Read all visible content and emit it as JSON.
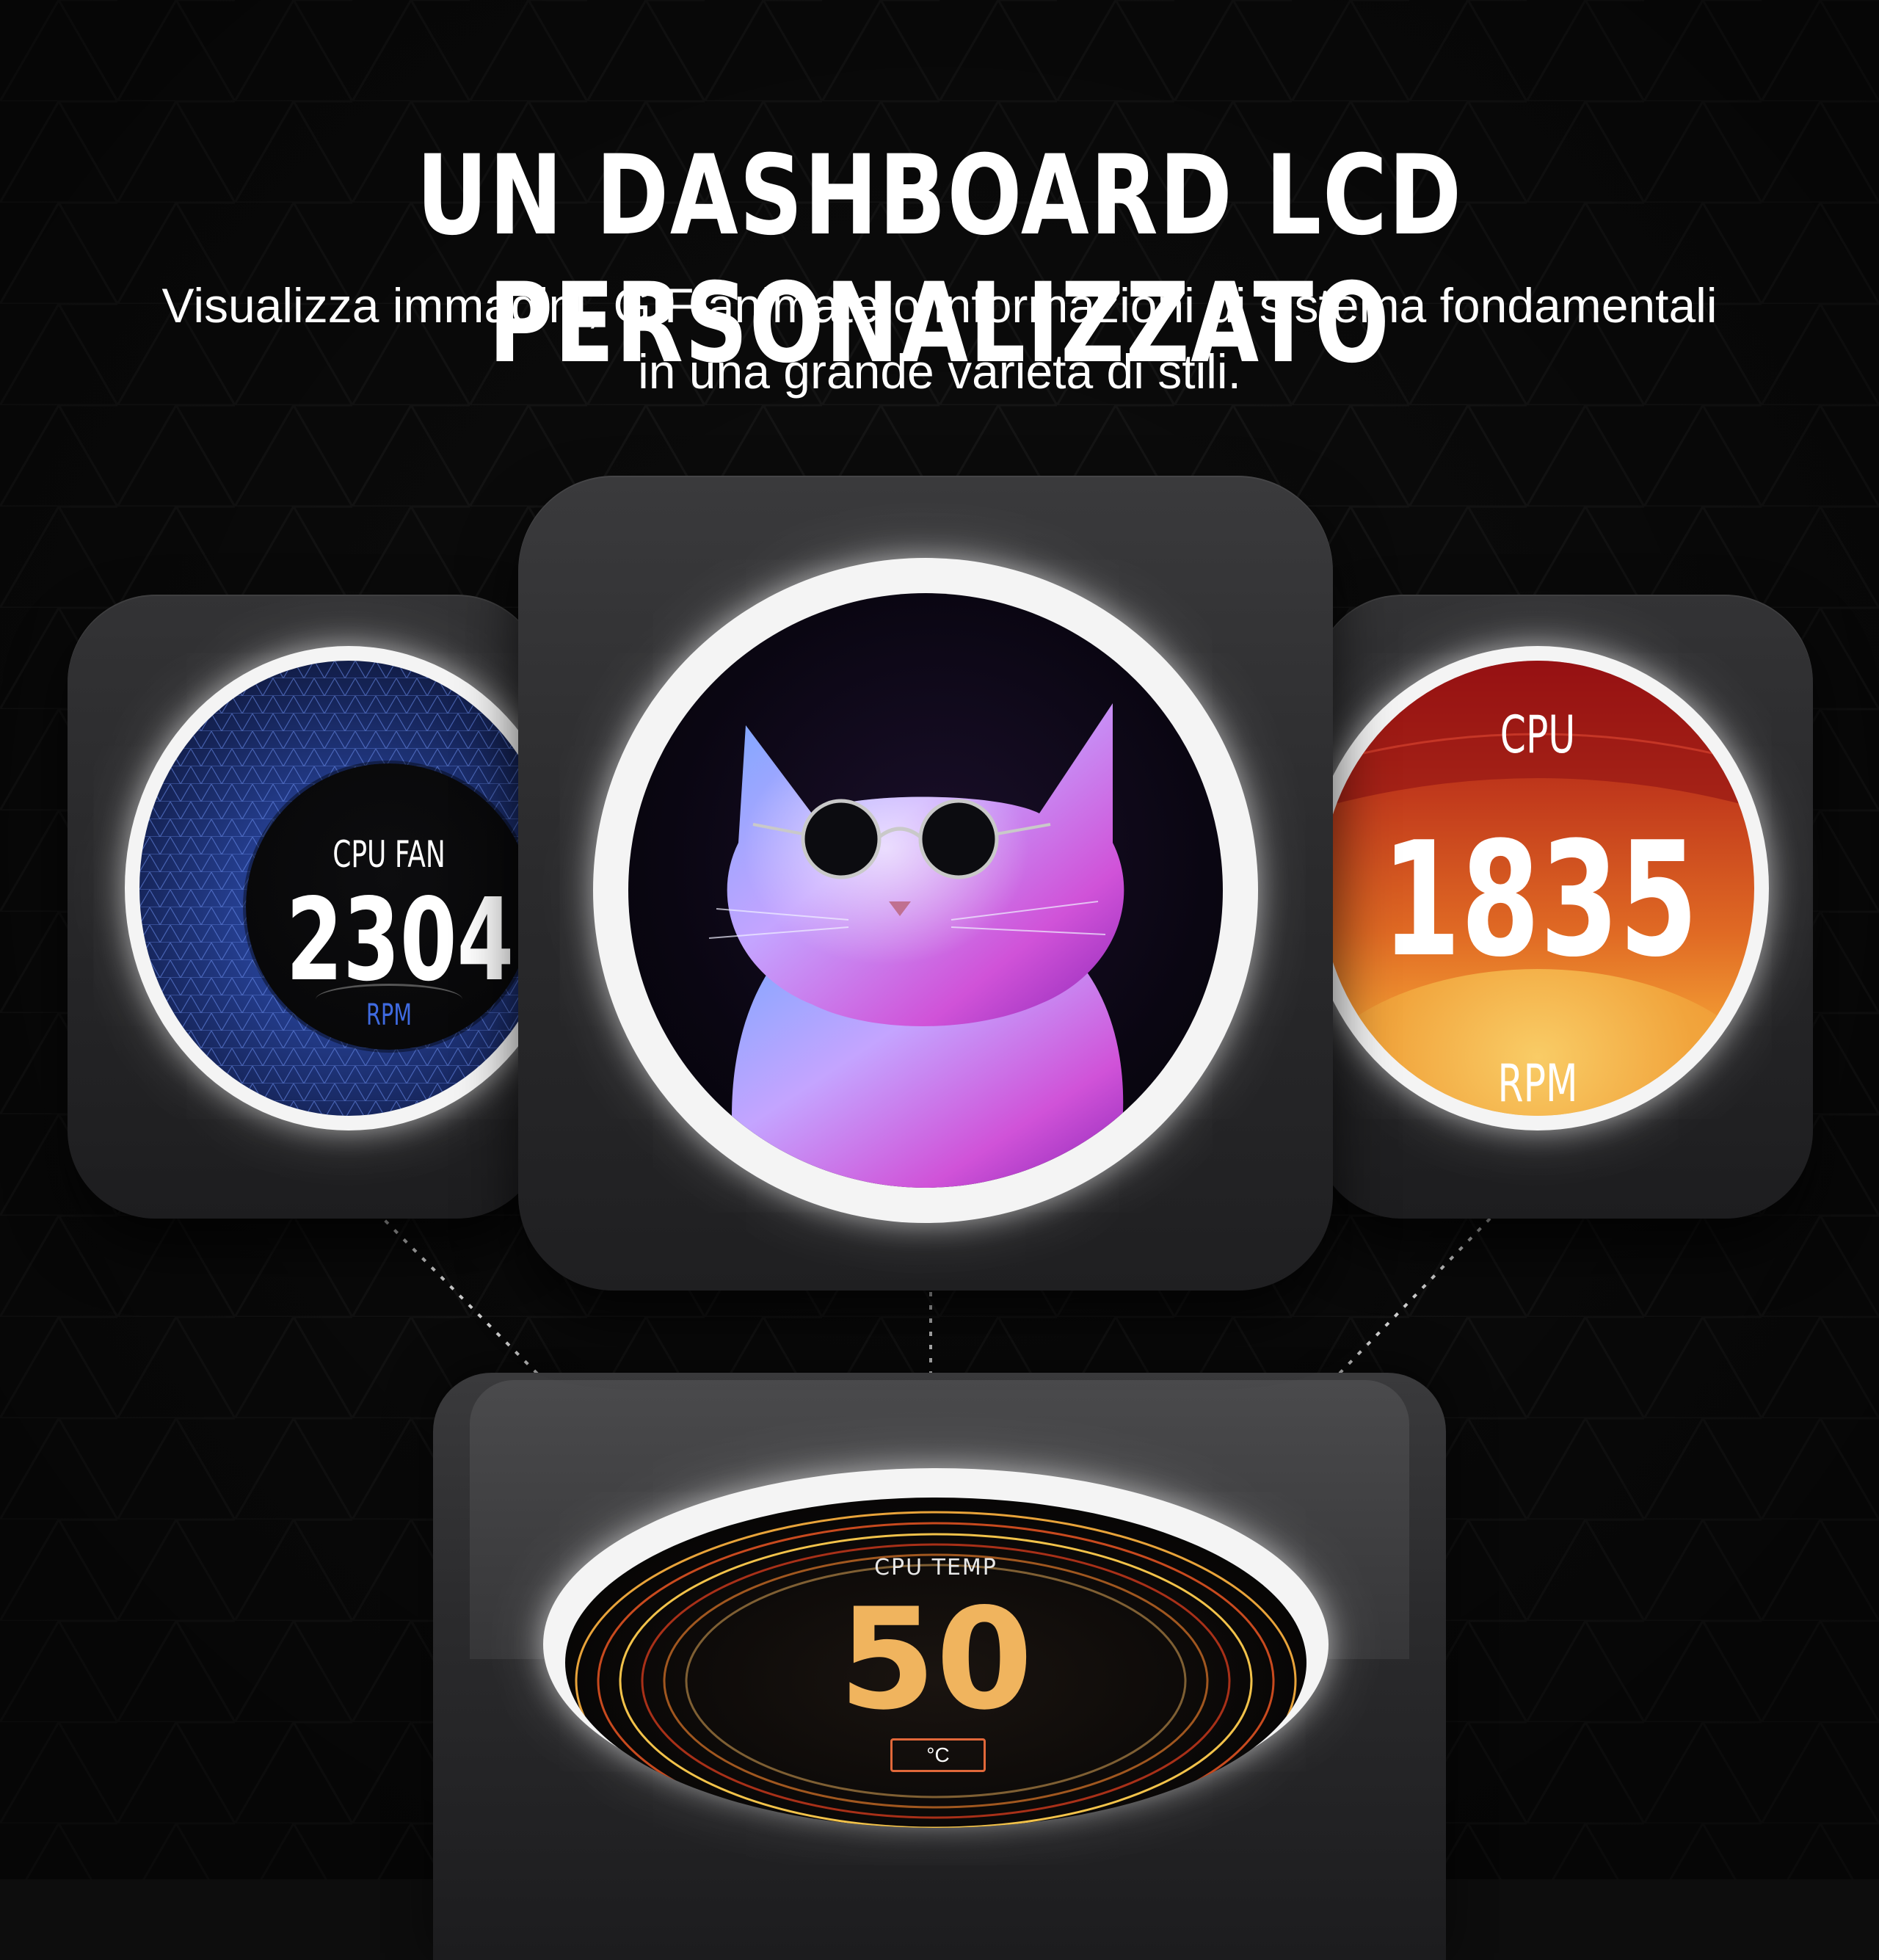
{
  "header": {
    "title": "UN DASHBOARD LCD PERSONALIZZATO",
    "subtitle_line1": "Visualizza immagini, GIF animate o informazioni di sistema fondamentali",
    "subtitle_line2": "in una grande varietà di stili."
  },
  "displays": {
    "left": {
      "title": "CPU FAN",
      "value": "2304",
      "unit": "RPM"
    },
    "center": {
      "image": "cat-with-sunglasses"
    },
    "right": {
      "title": "CPU",
      "value": "1835",
      "unit": "RPM"
    },
    "bottom": {
      "title": "CPU TEMP",
      "value": "50",
      "unit": "°C"
    }
  },
  "colors": {
    "background": "#0d0d0d",
    "left_accent": "#3f6ae0",
    "right_top": "#a21414",
    "right_bottom": "#f6bd55",
    "temp_value": "#f0b45e",
    "temp_box": "#e1683a"
  }
}
